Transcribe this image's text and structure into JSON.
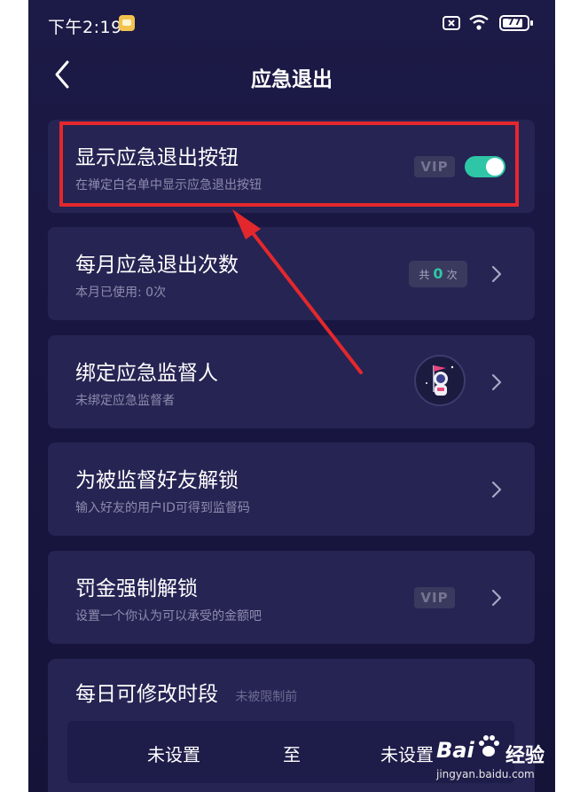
{
  "status_bar": {
    "time": "下午2:19",
    "battery": "77"
  },
  "header": {
    "title": "应急退出"
  },
  "settings": [
    {
      "title": "显示应急退出按钮",
      "subtitle": "在禅定白名单中显示应急退出按钮",
      "vip": "VIP",
      "toggle_on": true
    },
    {
      "title": "每月应急退出次数",
      "subtitle": "本月已使用: 0次",
      "badge_prefix": "共",
      "badge_count": "0",
      "badge_suffix": "次"
    },
    {
      "title": "绑定应急监督人",
      "subtitle": "未绑定应急监督者"
    },
    {
      "title": "为被监督好友解锁",
      "subtitle": "输入好友的用户ID可得到监督码"
    },
    {
      "title": "罚金强制解锁",
      "subtitle": "设置一个你认为可以承受的金额吧",
      "vip": "VIP"
    }
  ],
  "daily_window": {
    "title": "每日可修改时段",
    "note": "未被限制前",
    "start": "未设置",
    "separator": "至",
    "end": "未设置"
  },
  "watermark": {
    "logo_text": "Bai",
    "brand": "经验",
    "url": "jingyan.baidu.com"
  },
  "colors": {
    "accent": "#2fc6a7",
    "highlight": "#e3282d",
    "card": "#262453",
    "background": "#1b1942"
  }
}
